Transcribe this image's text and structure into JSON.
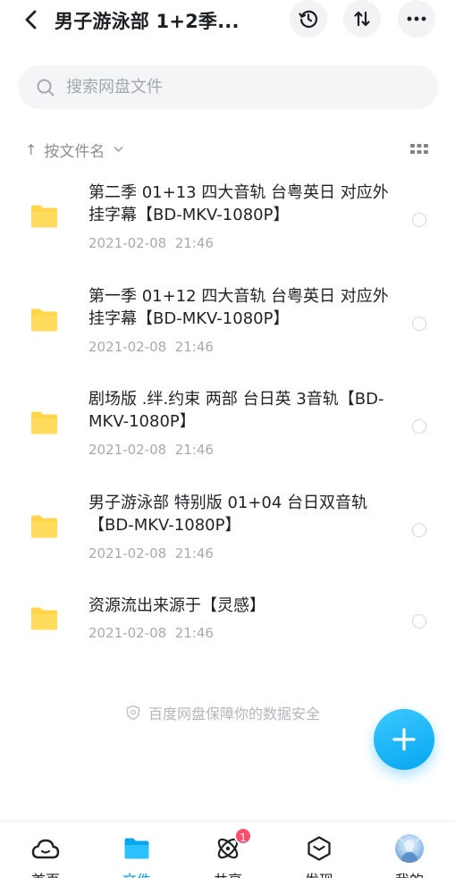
{
  "header": {
    "title": "男子游泳部 1+2季..."
  },
  "search": {
    "placeholder": "搜索网盘文件"
  },
  "sortbar": {
    "label": "按文件名"
  },
  "files": [
    {
      "name": "第二季 01+13 四大音轨 台粤英日 对应外挂字幕【BD-MKV-1080P】",
      "date": "2021-02-08  21:46"
    },
    {
      "name": "第一季 01+12 四大音轨 台粤英日 对应外挂字幕【BD-MKV-1080P】",
      "date": "2021-02-08  21:46"
    },
    {
      "name": "剧场版 .绊.约束 两部 台日英 3音轨【BD-MKV-1080P】",
      "date": "2021-02-08  21:46"
    },
    {
      "name": "男子游泳部 特别版 01+04 台日双音轨【BD-MKV-1080P】",
      "date": "2021-02-08  21:46"
    },
    {
      "name": "资源流出来源于【灵感】",
      "date": "2021-02-08  21:46"
    }
  ],
  "security_note": "百度网盘保障你的数据安全",
  "bottom_nav": [
    {
      "label": "首页",
      "icon": "cloud-icon"
    },
    {
      "label": "文件",
      "icon": "folder-icon",
      "active": true
    },
    {
      "label": "共享",
      "icon": "share-atom-icon",
      "badge": "1"
    },
    {
      "label": "发现",
      "icon": "discover-cube-icon"
    },
    {
      "label": "我的",
      "icon": "avatar"
    }
  ],
  "colors": {
    "accent": "#06a7f0",
    "folder": "#ffd54a",
    "badge": "#ff4d6a"
  }
}
